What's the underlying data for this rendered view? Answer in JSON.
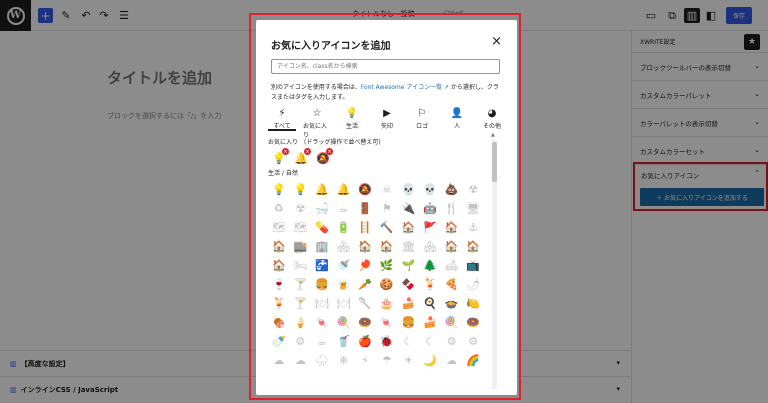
{
  "topbar": {
    "logo": "W",
    "add_icon": "+",
    "doc_title": "タイトルなし · 投稿",
    "shortcut": "Ctrl+K",
    "save_label": "保存"
  },
  "canvas": {
    "post_title_placeholder": "タイトルを追加",
    "block_hint": "ブロックを選択するには「/」を入力"
  },
  "bottom_panels": [
    {
      "label": "【高度な設定】"
    },
    {
      "label": "インラインCSS / JavaScript"
    }
  ],
  "sidebar": {
    "header": "XWRITE設定",
    "items": [
      {
        "label": "ブロックツールバーの表示切替"
      },
      {
        "label": "カスタムカラーパレット"
      },
      {
        "label": "カラーパレットの表示切替"
      },
      {
        "label": "カスタムカラーセット"
      }
    ],
    "favorites": {
      "title": "お気に入りアイコン",
      "button": "＋ お気に入りアイコンを追加する"
    }
  },
  "modal": {
    "title": "お気に入りアイコンを追加",
    "close_icon": "×",
    "search_placeholder": "アイコン名、class名から検索",
    "desc_before": "別のアイコンを使用する場合は、",
    "desc_link": "Font Awesome アイコン一覧 ↗",
    "desc_after": " から選択し、クラスまたはタグを入力します。",
    "categories": [
      {
        "label": "すべて",
        "icon": "⚡"
      },
      {
        "label": "お気に入り",
        "icon": "☆"
      },
      {
        "label": "生活",
        "icon": "💡"
      },
      {
        "label": "矢印",
        "icon": "▶"
      },
      {
        "label": "ロゴ",
        "icon": "⚐"
      },
      {
        "label": "人",
        "icon": "👤"
      },
      {
        "label": "その他",
        "icon": "◕"
      }
    ],
    "favorites_label": "お気に入り　(ドラッグ操作で並べ替え可)",
    "favorite_icons": [
      "💡",
      "🔔",
      "🔕"
    ],
    "badge": "×",
    "life_label": "生活 / 自然",
    "life_icons": [
      "💡",
      "💡",
      "🔔",
      "🔔",
      "🔕",
      "☠",
      "💀",
      "💀",
      "💩",
      "☢",
      "♻",
      "☢",
      "🛁",
      "☕",
      "🚪",
      "⚑",
      "🔌",
      "🤖",
      "🍴",
      "🖥",
      "🗺",
      "🗺",
      "💊",
      "🔋",
      "🪜",
      "🔨",
      "🏠",
      "🚩",
      "🏠",
      "⚓",
      "🏠",
      "🏬",
      "🏢",
      "🏘",
      "🏠",
      "🏠",
      "🏛",
      "🏘",
      "🏠",
      "🏠",
      "🏠",
      "🛏",
      "🚰",
      "🚿",
      "🏓",
      "🌿",
      "🌱",
      "🌲",
      "🛋",
      "📺",
      "🍷",
      "🍸",
      "🍔",
      "🍺",
      "🥕",
      "🍪",
      "🍫",
      "🍹",
      "🍕",
      "🌶",
      "🍹",
      "🍸",
      "🍽",
      "🍽",
      "🥄",
      "🎂",
      "🍰",
      "🍳",
      "🍲",
      "🍋",
      "🍖",
      "🍦",
      "🍬",
      "🍭",
      "🍩",
      "🍬",
      "🍔",
      "🍰",
      "🍭",
      "🍩",
      "🍼",
      "⚙",
      "☕",
      "🥤",
      "🍎",
      "🐞",
      "☾",
      "☾",
      "⚙",
      "⚙",
      "☁",
      "☁",
      "🌧",
      "❄",
      "⚡",
      "☂",
      "☀",
      "🌙",
      "☁",
      "🌈"
    ]
  }
}
